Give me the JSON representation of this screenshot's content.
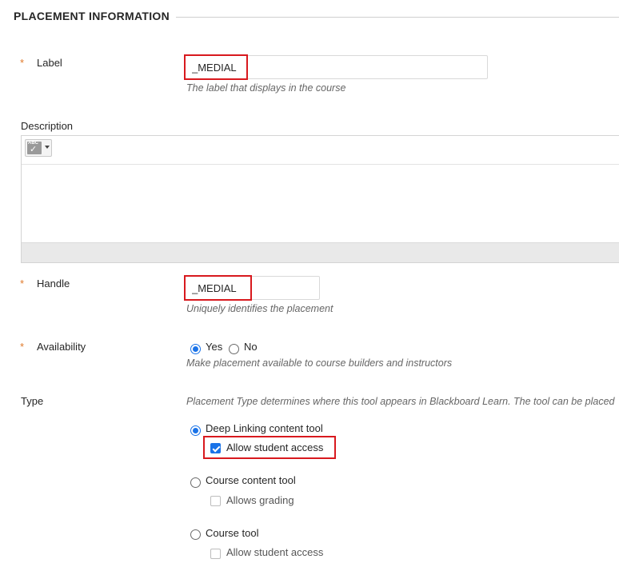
{
  "section": {
    "title": "PLACEMENT INFORMATION"
  },
  "label_field": {
    "label": "Label",
    "required_mark": "*",
    "value": "_MEDIAL",
    "hint": "The label that displays in the course"
  },
  "description_field": {
    "label": "Description",
    "toolbar": {
      "spellcheck_abbr": "ABC",
      "spellcheck_icon": "spellcheck-icon"
    }
  },
  "handle_field": {
    "label": "Handle",
    "required_mark": "*",
    "value": "_MEDIAL",
    "hint": "Uniquely identifies the placement"
  },
  "availability_field": {
    "label": "Availability",
    "required_mark": "*",
    "options": [
      {
        "label": "Yes",
        "checked": true
      },
      {
        "label": "No",
        "checked": false
      }
    ],
    "hint": "Make placement available to course builders and instructors"
  },
  "type_field": {
    "label": "Type",
    "description": "Placement Type determines where this tool appears in Blackboard Learn. The tool can be placed",
    "options": [
      {
        "label": "Deep Linking content tool",
        "checked": true,
        "sub_option": {
          "label": "Allow student access",
          "checked": true
        }
      },
      {
        "label": "Course content tool",
        "checked": false,
        "sub_option": {
          "label": "Allows grading",
          "checked": false
        }
      },
      {
        "label": "Course tool",
        "checked": false,
        "sub_option": {
          "label": "Allow student access",
          "checked": false
        }
      }
    ]
  },
  "colors": {
    "accent": "#1a73e8",
    "required": "#e07a2b",
    "highlight": "#d8191e"
  }
}
